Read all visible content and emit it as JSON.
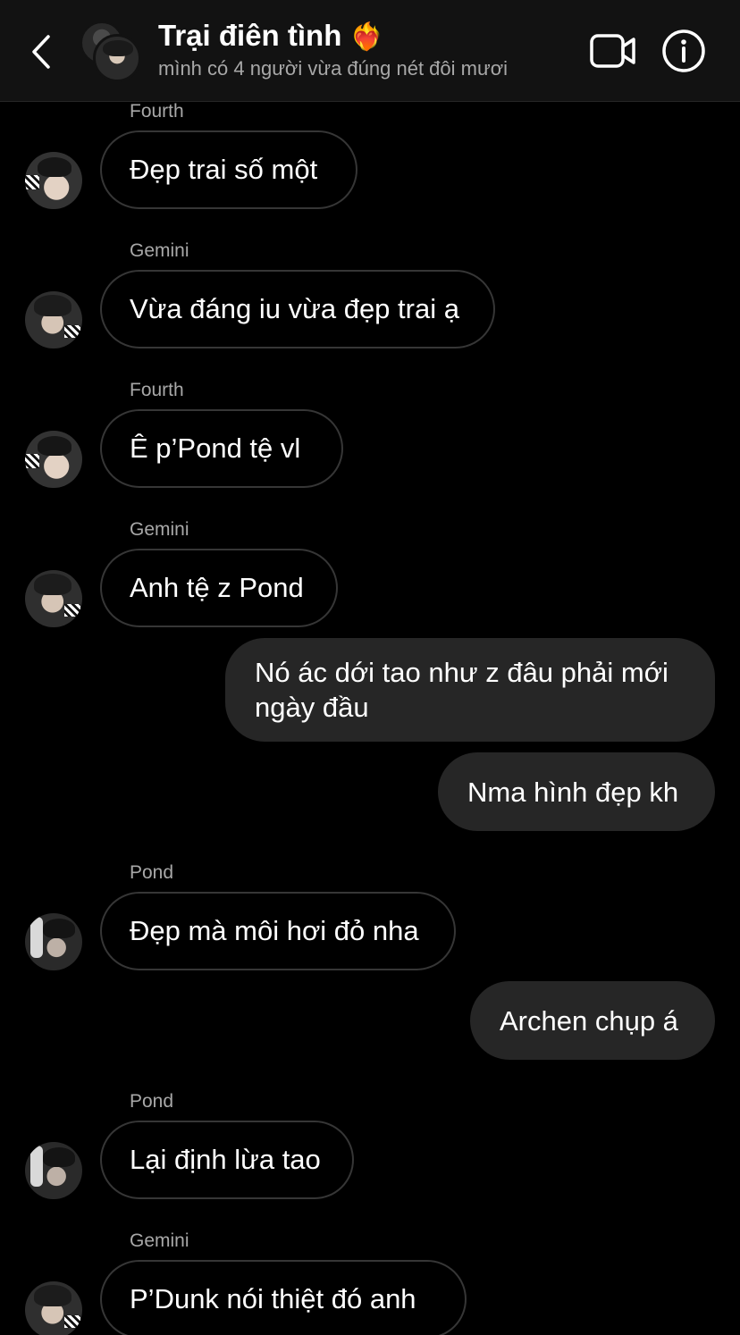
{
  "header": {
    "title": "Trại điên tình",
    "title_emoji": "❤️‍🔥",
    "subtitle": "mình có 4 người vừa đúng nét đôi mươi",
    "back_icon": "chevron-left-icon",
    "video_icon": "video-camera-icon",
    "info_icon": "info-icon"
  },
  "messages": [
    {
      "sender": "Fourth",
      "text": "Đẹp trai số một"
    },
    {
      "sender": "Gemini",
      "text": "Vừa đáng iu vừa đẹp trai ạ"
    },
    {
      "sender": "Fourth",
      "text": "Ê p’Pond tệ vl"
    },
    {
      "sender": "Gemini",
      "text": "Anh tệ z Pond"
    },
    {
      "sender": "me",
      "text_line1": "Nó ác dới tao như z đâu phải mới",
      "text_line2": "ngày đầu"
    },
    {
      "sender": "me",
      "text": "Nma hình đẹp kh"
    },
    {
      "sender": "Pond",
      "text": "Đẹp mà môi hơi đỏ nha"
    },
    {
      "sender": "me",
      "text": "Archen chụp á"
    },
    {
      "sender": "Pond",
      "text": "Lại định lừa tao"
    },
    {
      "sender": "Gemini",
      "text": "P’Dunk nói thiệt đó anh"
    }
  ],
  "colors": {
    "background": "#000000",
    "header_bg": "#121212",
    "outgoing_bubble": "#262626",
    "incoming_border": "#363636",
    "secondary_text": "#a8a8a8"
  }
}
